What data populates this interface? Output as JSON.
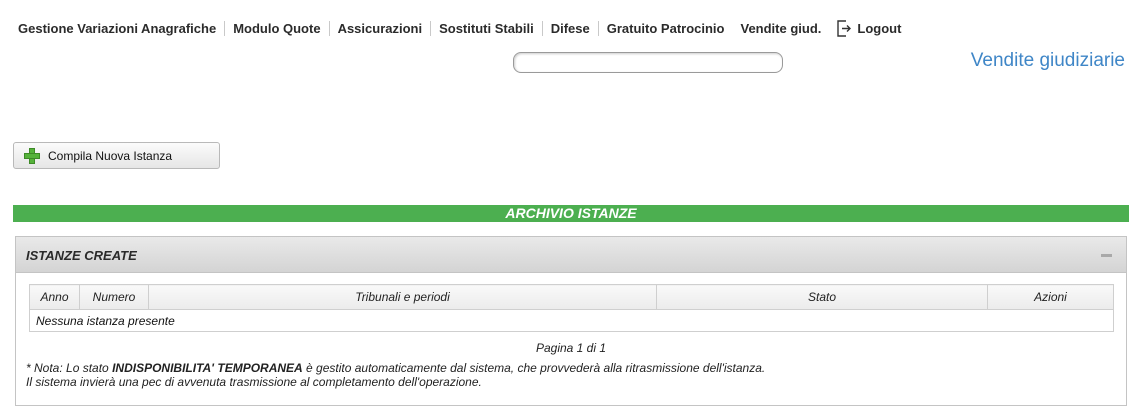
{
  "nav": {
    "items": [
      "Gestione Variazioni Anagrafiche",
      "Modulo Quote",
      "Assicurazioni",
      "Sostituti Stabili",
      "Difese",
      "Gratuito Patrocinio",
      "Vendite giud."
    ],
    "logout_label": "Logout",
    "logout_icon": "logout-icon"
  },
  "search": {
    "value": "",
    "placeholder": ""
  },
  "page_heading": "Vendite giudiziarie",
  "new_button": {
    "label": "Compila Nuova Istanza",
    "icon": "plus-icon"
  },
  "archive_bar": "ARCHIVIO ISTANZE",
  "panel": {
    "title": "ISTANZE CREATE",
    "columns": [
      "Anno",
      "Numero",
      "Tribunali e periodi",
      "Stato",
      "Azioni"
    ],
    "empty_message": "Nessuna istanza presente",
    "pager": "Pagina 1 di 1"
  },
  "note": {
    "prefix": "* Nota: Lo stato ",
    "emphasis": "INDISPONIBILITA' TEMPORANEA",
    "suffix": " è gestito automaticamente dal sistema, che provvederà alla ritrasmissione dell'istanza.",
    "line2": "Il sistema invierà una pec di avvenuta trasmissione al completamento dell'operazione."
  },
  "colors": {
    "accent_green": "#4caf50",
    "heading_blue": "#3f86c7"
  }
}
